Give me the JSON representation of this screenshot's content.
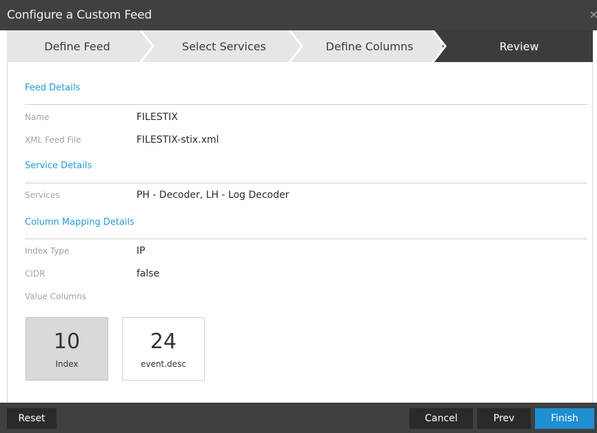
{
  "window": {
    "title": "Configure a Custom Feed",
    "close_icon": "close-icon"
  },
  "steps": [
    {
      "label": "Define Feed",
      "active": false
    },
    {
      "label": "Select Services",
      "active": false
    },
    {
      "label": "Define Columns",
      "active": false
    },
    {
      "label": "Review",
      "active": true
    }
  ],
  "feed_details": {
    "title": "Feed Details",
    "name_label": "Name",
    "name_value": "FILESTIX",
    "xml_label": "XML Feed File",
    "xml_value": "FILESTIX-stix.xml"
  },
  "service_details": {
    "title": "Service Details",
    "services_label": "Services",
    "services_value": "PH - Decoder,  LH - Log Decoder"
  },
  "column_mapping": {
    "title": "Column Mapping Details",
    "index_type_label": "Index Type",
    "index_type_value": "IP",
    "cidr_label": "CIDR",
    "cidr_value": "false",
    "value_columns_label": "Value Columns",
    "tiles": [
      {
        "number": "10",
        "name": "Index",
        "highlighted": true
      },
      {
        "number": "24",
        "name": "event.desc",
        "highlighted": false
      }
    ]
  },
  "footer": {
    "reset_label": "Reset",
    "cancel_label": "Cancel",
    "prev_label": "Prev",
    "finish_label": "Finish"
  },
  "colors": {
    "accent": "#1f9bd7",
    "primary_button": "#1e8fd0",
    "title_bar": "#404040",
    "active_step": "#3c3c3c"
  }
}
